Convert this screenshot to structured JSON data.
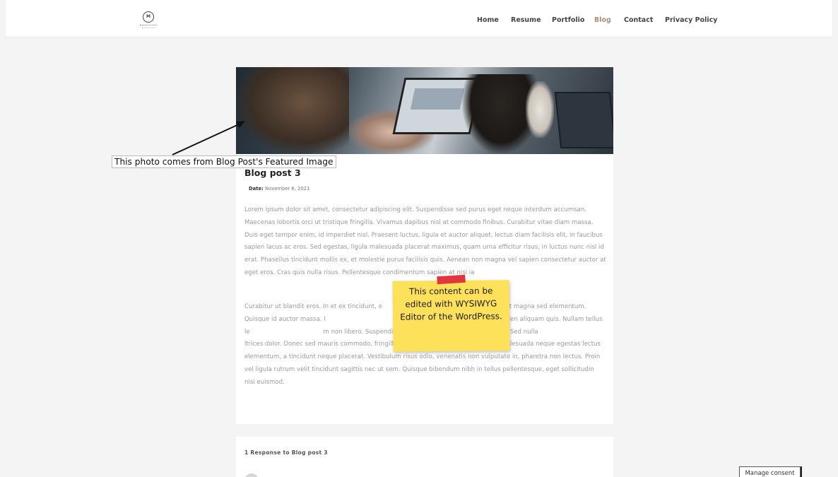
{
  "nav": {
    "items": [
      "Home",
      "Resume",
      "Portfolio",
      "Blog",
      "Contact",
      "Privacy Policy"
    ],
    "active": "Blog"
  },
  "post": {
    "title": "Blog post 3",
    "date_label": "Date:",
    "date_value": "November 6, 2021",
    "paragraph1": "Lorem ipsum dolor sit amet, consectetur adipiscing elit. Suspendisse sed purus eget neque interdum accumsan. Maecenas lobortis orci ut tristique fringilla. Vivamus dapibus nisl at commodo finibus. Curabitur vitae diam massa. Duis eget tempor enim, id imperdiet nisl. Praesent luctus, ligula et auctor aliquet, lectus diam facilisis elit, in faucibus sapien lacus ac eros. Sed egestas, ligula malesuada placerat maximus, quam urna efficitur risus, in luctus nunc nisl id erat. Phasellus tincidunt mollis ex, et molestie purus facilisis quis. Aenean non magna vel sapien consectetur auctor at eget eros. Cras quis nulla risus. Pellentesque condimentum sapien at nisi ia",
    "paragraph2": "Curabitur ut blandit eros. In et ex tincidunt, e                                      aecenas aliquet at magna sed elementum. Quisque id auctor massa. I                                      ectetur metus lectus, vel iaculis sapien aliquam quis. Nullam tellus le                                      m non libero. Suspendisse ac ex id lorem luctus ullamcorper. Sed nulla                                      ltrices dolor. Donec sed mauris commodo, fringilla lectus ac, euismod quam. Donec malesuada neque egestas lectus elementum, a tincidunt neque placerat. Vestibulum risus odio, venenatis non vulputate in, pharetra non lectus. Proin vel ligula rutrum velit tincidunt sagittis nec ut sem. Quisque bibendum nibh in tellus pellentesque, eget sollicitudin nisi euismod."
  },
  "comments": {
    "title": "1 Response to Blog post 3"
  },
  "annotations": {
    "featured_image": "This photo comes from Blog Post's Featured Image",
    "sticky_note": "This content can be edited with WYSIWYG Editor of the WordPress.",
    "sticky_color": "#fde15b",
    "tape_color": "#e2363f"
  },
  "consent": {
    "label": "Manage consent"
  },
  "colors": {
    "accent": "#b08e7a",
    "background": "#f4f4f4"
  }
}
